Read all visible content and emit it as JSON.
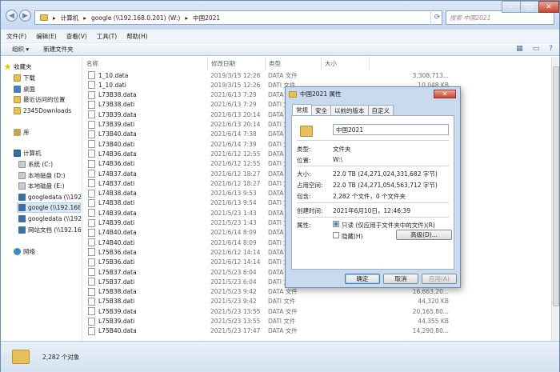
{
  "address": {
    "segments": [
      "计算机",
      "google (\\\\192.168.0.201) (W:)",
      "中国2021"
    ],
    "search_placeholder": "搜索 中国2021"
  },
  "menu": [
    "文件(F)",
    "编辑(E)",
    "查看(V)",
    "工具(T)",
    "帮助(H)"
  ],
  "toolbar": {
    "organize": "组织 ▾",
    "new_folder": "新建文件夹"
  },
  "nav": {
    "favorites": "收藏夹",
    "fav_items": [
      "下载",
      "桌面",
      "最近访问的位置",
      "2345Downloads"
    ],
    "library": "库",
    "computer": "计算机",
    "drives": [
      "系统 (C:)",
      "本地磁盘 (D:)",
      "本地磁盘 (E:)",
      "googledata (\\\\192",
      "google (\\\\192.168",
      "googledata (\\\\192",
      "网站文档 (\\\\192.16"
    ],
    "network": "网络"
  },
  "columns": {
    "name": "名称",
    "date": "修改日期",
    "type": "类型",
    "size": "大小"
  },
  "files": [
    {
      "name": "1_10.data",
      "date": "2019/3/15 12:26",
      "type": "DATA 文件",
      "size": "3,308,713..."
    },
    {
      "name": "1_10.dati",
      "date": "2019/3/15 12:26",
      "type": "DATI 文件",
      "size": "10,048 KB"
    },
    {
      "name": "L73B38.data",
      "date": "2021/6/13 7:29",
      "type": "DATA 文件",
      "size": ""
    },
    {
      "name": "L73B38.dati",
      "date": "2021/6/13 7:29",
      "type": "DATI 文件",
      "size": ""
    },
    {
      "name": "L73B39.data",
      "date": "2021/6/13 20:14",
      "type": "DATA 文件",
      "size": ""
    },
    {
      "name": "L73B39.dati",
      "date": "2021/6/13 20:14",
      "type": "DATI 文件",
      "size": ""
    },
    {
      "name": "L73B40.data",
      "date": "2021/6/14 7:38",
      "type": "DATA 文件",
      "size": ""
    },
    {
      "name": "L73B40.dati",
      "date": "2021/6/14 7:39",
      "type": "DATI 文件",
      "size": ""
    },
    {
      "name": "L74B36.data",
      "date": "2021/6/12 12:55",
      "type": "DATA 文件",
      "size": ""
    },
    {
      "name": "L74B36.dati",
      "date": "2021/6/12 12:55",
      "type": "DATI 文件",
      "size": ""
    },
    {
      "name": "L74B37.data",
      "date": "2021/6/12 18:27",
      "type": "DATA 文件",
      "size": ""
    },
    {
      "name": "L74B37.dati",
      "date": "2021/6/12 18:27",
      "type": "DATI 文件",
      "size": ""
    },
    {
      "name": "L74B38.data",
      "date": "2021/6/13 9:53",
      "type": "DATA 文件",
      "size": ""
    },
    {
      "name": "L74B38.dati",
      "date": "2021/6/13 9:54",
      "type": "DATI 文件",
      "size": ""
    },
    {
      "name": "L74B39.data",
      "date": "2021/5/23 1:43",
      "type": "DATA 文件",
      "size": ""
    },
    {
      "name": "L74B39.dati",
      "date": "2021/5/23 1:43",
      "type": "DATI 文件",
      "size": ""
    },
    {
      "name": "L74B40.data",
      "date": "2021/6/14 8:09",
      "type": "DATA 文件",
      "size": ""
    },
    {
      "name": "L74B40.dati",
      "date": "2021/6/14 8:09",
      "type": "DATI 文件",
      "size": ""
    },
    {
      "name": "L75B36.data",
      "date": "2021/6/12 14:14",
      "type": "DATA 文件",
      "size": ""
    },
    {
      "name": "L75B36.dati",
      "date": "2021/6/12 14:14",
      "type": "DATI 文件",
      "size": ""
    },
    {
      "name": "L75B37.data",
      "date": "2021/5/23 6:04",
      "type": "DATA 文件",
      "size": ""
    },
    {
      "name": "L75B37.dati",
      "date": "2021/5/23 6:04",
      "type": "DATI 文件",
      "size": ""
    },
    {
      "name": "L75B38.data",
      "date": "2021/5/23 9:42",
      "type": "DATA 文件",
      "size": "16,663,20..."
    },
    {
      "name": "L75B38.dati",
      "date": "2021/5/23 9:42",
      "type": "DATI 文件",
      "size": "44,320 KB"
    },
    {
      "name": "L75B39.data",
      "date": "2021/5/23 13:55",
      "type": "DATA 文件",
      "size": "20,165,80..."
    },
    {
      "name": "L75B39.dati",
      "date": "2021/5/23 13:55",
      "type": "DATI 文件",
      "size": "44,355 KB"
    },
    {
      "name": "L75B40.data",
      "date": "2021/5/23 17:47",
      "type": "DATA 文件",
      "size": "14,290,80..."
    }
  ],
  "status": {
    "count": "2,282 个对象"
  },
  "dialog": {
    "title": "中国2021 属性",
    "tabs": [
      "常规",
      "安全",
      "以前的版本",
      "自定义"
    ],
    "name": "中国2021",
    "type_label": "类型:",
    "type_value": "文件夹",
    "location_label": "位置:",
    "location_value": "W:\\",
    "size_label": "大小:",
    "size_value": "22.0 TB (24,271,024,331,682 字节)",
    "disk_label": "占用空间:",
    "disk_value": "22.0 TB (24,271,054,563,712 字节)",
    "contains_label": "包含:",
    "contains_value": "2,282 个文件，0 个文件夹",
    "created_label": "创建时间:",
    "created_value": "2021年6月10日，12:46:39",
    "attr_label": "属性:",
    "readonly": "只读 (仅应用于文件夹中的文件)(R)",
    "hidden": "隐藏(H)",
    "advanced": "高级(D)...",
    "ok": "确定",
    "cancel": "取消",
    "apply": "应用(A)"
  }
}
